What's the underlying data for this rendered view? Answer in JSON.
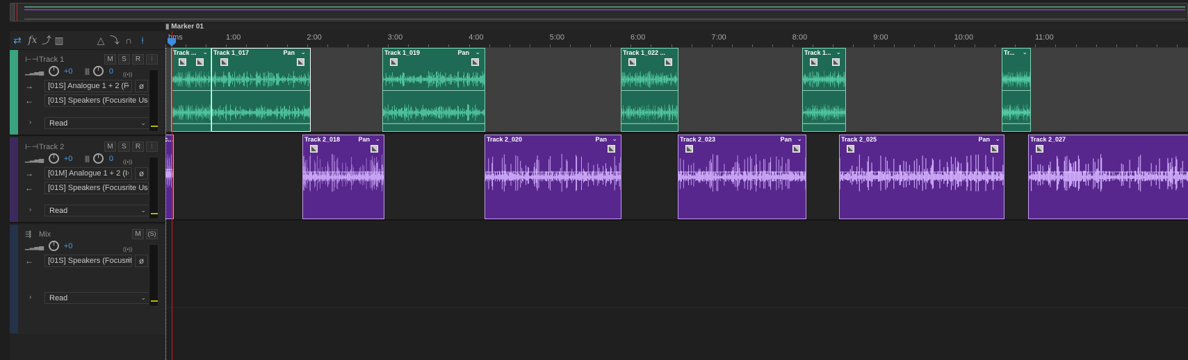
{
  "toolbar": {
    "icons": [
      "switch-icon",
      "fx-icon",
      "sends-icon",
      "eq-icon",
      "metronome-icon",
      "punch-icon",
      "snap-icon",
      "marker-tool-icon"
    ],
    "fx_glyph": "fx"
  },
  "timeline": {
    "marker_label": "Marker 01",
    "time_format": "hms",
    "ruler_labels": [
      "1:00",
      "2:00",
      "3:00",
      "4:00",
      "5:00",
      "6:00",
      "7:00",
      "8:00",
      "9:00",
      "10:00",
      "11:00"
    ]
  },
  "tracks": [
    {
      "name": "Track 1",
      "color": "#3aa37f",
      "mute": "M",
      "solo": "S",
      "record": "R",
      "input_monitor": "I",
      "volume": "+0",
      "pan": "0",
      "input": "[01S] Analogue 1 + 2 (F",
      "output": "[01S] Speakers (Focusrite Us",
      "automation": "Read",
      "clips": [
        {
          "title": "Track ...",
          "pan": ""
        },
        {
          "title": "Track 1_017",
          "pan": "Pan"
        },
        {
          "title": "Track 1_019",
          "pan": "Pan"
        },
        {
          "title": "Track 1_022 ...",
          "pan": ""
        },
        {
          "title": "Track 1...",
          "pan": ""
        },
        {
          "title": "Tr...",
          "pan": ""
        }
      ]
    },
    {
      "name": "Track 2",
      "color": "#6c2fb0",
      "mute": "M",
      "solo": "S",
      "record": "R",
      "input_monitor": "I",
      "volume": "+0",
      "pan": "0",
      "input": "[01M] Analogue 1 + 2 (I",
      "output": "[01S] Speakers (Focusrite Us",
      "automation": "Read",
      "clips": [
        {
          "title": "Trac...",
          "pan": ""
        },
        {
          "title": "Track 2_018",
          "pan": "Pan"
        },
        {
          "title": "Track 2_020",
          "pan": "Pan"
        },
        {
          "title": "Track 2_023",
          "pan": "Pan"
        },
        {
          "title": "Track 2_025",
          "pan": "Pan"
        },
        {
          "title": "Track 2_027",
          "pan": ""
        }
      ]
    }
  ],
  "mix": {
    "name": "Mix",
    "color": "#24324a",
    "mute": "M",
    "solo": "(S)",
    "volume": "+0",
    "output": "[01S] Speakers (Focusrit",
    "automation": "Read"
  },
  "colors": {
    "green_clip": "#1f6a54",
    "purple_clip": "#57278d",
    "green_wave": "#5fe0b3",
    "purple_wave": "#d4b0ff",
    "playhead": "#d02020",
    "accent_blue": "#4a9de8"
  }
}
